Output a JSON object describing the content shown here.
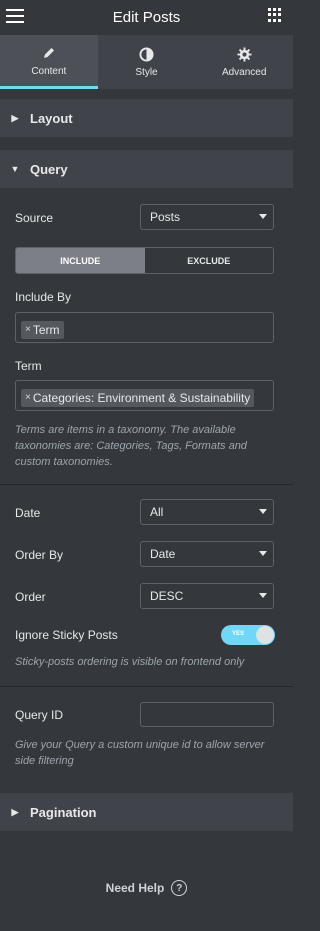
{
  "header": {
    "title": "Edit Posts"
  },
  "tabs": [
    {
      "label": "Content",
      "icon": "pencil-icon"
    },
    {
      "label": "Style",
      "icon": "contrast-icon"
    },
    {
      "label": "Advanced",
      "icon": "gear-icon"
    }
  ],
  "sections": {
    "layout": "Layout",
    "query": "Query",
    "pagination": "Pagination"
  },
  "query": {
    "source_label": "Source",
    "source_value": "Posts",
    "include_label": "INCLUDE",
    "exclude_label": "EXCLUDE",
    "include_by_label": "Include By",
    "include_by_tag": "Term",
    "term_label": "Term",
    "term_tag": "Categories: Environment & Sustainability",
    "term_help": "Terms are items in a taxonomy. The available taxonomies are: Categories, Tags, Formats and custom taxonomies.",
    "date_label": "Date",
    "date_value": "All",
    "orderby_label": "Order By",
    "orderby_value": "Date",
    "order_label": "Order",
    "order_value": "DESC",
    "sticky_label": "Ignore Sticky Posts",
    "sticky_toggle": "YES",
    "sticky_help": "Sticky-posts ordering is visible on frontend only",
    "queryid_label": "Query ID",
    "queryid_value": "",
    "queryid_help": "Give your Query a custom unique id to allow server side filtering"
  },
  "footer": {
    "need_help": "Need Help"
  },
  "colors": {
    "accent": "#71d7f7",
    "panel": "#34383c",
    "section": "#404349"
  }
}
